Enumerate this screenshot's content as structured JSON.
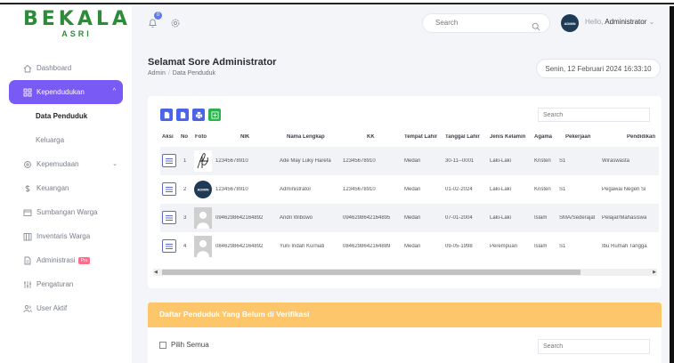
{
  "brand": {
    "name": "BEKALA",
    "sub": "ASRI"
  },
  "header": {
    "notification_count": "0",
    "search_placeholder": "Search",
    "avatar_text": "ADMIN",
    "hello_prefix": "Hello,",
    "user_name": "Administrator",
    "user_chevron": "⌄"
  },
  "sidebar": {
    "items": [
      {
        "label": "Dashboard",
        "icon": "home-icon"
      },
      {
        "label": "Kependudukan",
        "icon": "grid-icon",
        "active": true,
        "chevron": "^"
      },
      {
        "label": "Kepemudaan",
        "icon": "settings-icon",
        "chevron": "⌄"
      },
      {
        "label": "Keuangan",
        "icon": "dollar-icon"
      },
      {
        "label": "Sumbangan Warga",
        "icon": "box-icon"
      },
      {
        "label": "Inventaris Warga",
        "icon": "inventory-icon"
      },
      {
        "label": "Administrasi",
        "icon": "file-icon",
        "badge": "Pro"
      },
      {
        "label": "Pengaturan",
        "icon": "sliders-icon"
      },
      {
        "label": "User Aktif",
        "icon": "users-icon"
      }
    ],
    "subitems": [
      {
        "label": "Data Penduduk",
        "current": true
      },
      {
        "label": "Keluarga"
      }
    ]
  },
  "page": {
    "title": "Selamat Sore Administrator",
    "breadcrumb": [
      "Admin",
      "Data Penduduk"
    ],
    "breadcrumb_sep": "/",
    "date": "Senin, 12 Februari 2024 16:33:10"
  },
  "table": {
    "search_placeholder": "Search",
    "columns": [
      "Aksi",
      "No",
      "Foto",
      "NIK",
      "Nama Lengkap",
      "KK",
      "Tempat Lahir",
      "Tanggal Lahir",
      "Jenis Kelamin",
      "Agama",
      "Pekerjaan",
      "Pendidikan"
    ],
    "rows": [
      {
        "no": "1",
        "photo": "signature",
        "nik": "12345678910",
        "nama": "Ade May Luky Harefa",
        "kk": "12345678910",
        "tempat": "Medan",
        "tanggal": "30-11--0001",
        "jk": "Laki-Laki",
        "agama": "Kristen",
        "pekerjaan": "S1",
        "pendidikan": "Wiraswasta"
      },
      {
        "no": "2",
        "photo": "admin",
        "nik": "12345678910",
        "nama": "Administrator",
        "kk": "12345678910",
        "tempat": "Medan",
        "tanggal": "01-02-2024",
        "jk": "Laki-Laki",
        "agama": "Kristen",
        "pekerjaan": "S1",
        "pendidikan": "Pegawai Negeri Si"
      },
      {
        "no": "3",
        "photo": "placeholder",
        "nik": "0946298642164892",
        "nama": "Andri Wibowo",
        "kk": "0946298642164895",
        "tempat": "Medan",
        "tanggal": "07-01-2004",
        "jk": "Laki-Laki",
        "agama": "Islam",
        "pekerjaan": "SMA/Sederajat",
        "pendidikan": "Pelajar/Mahasiswa"
      },
      {
        "no": "4",
        "photo": "placeholder",
        "nik": "0846298642164892",
        "nama": "Yuni Indah Kurniati",
        "kk": "0846298642164889",
        "tempat": "Medan",
        "tanggal": "09-05-1998",
        "jk": "Perempuan",
        "agama": "Islam",
        "pekerjaan": "S1",
        "pendidikan": "Ibu Rumah Tangga"
      }
    ]
  },
  "unverified": {
    "title": "Daftar Penduduk Yang Belum di Verifikasi",
    "select_all": "Pilih Semua",
    "search_placeholder": "Search"
  }
}
